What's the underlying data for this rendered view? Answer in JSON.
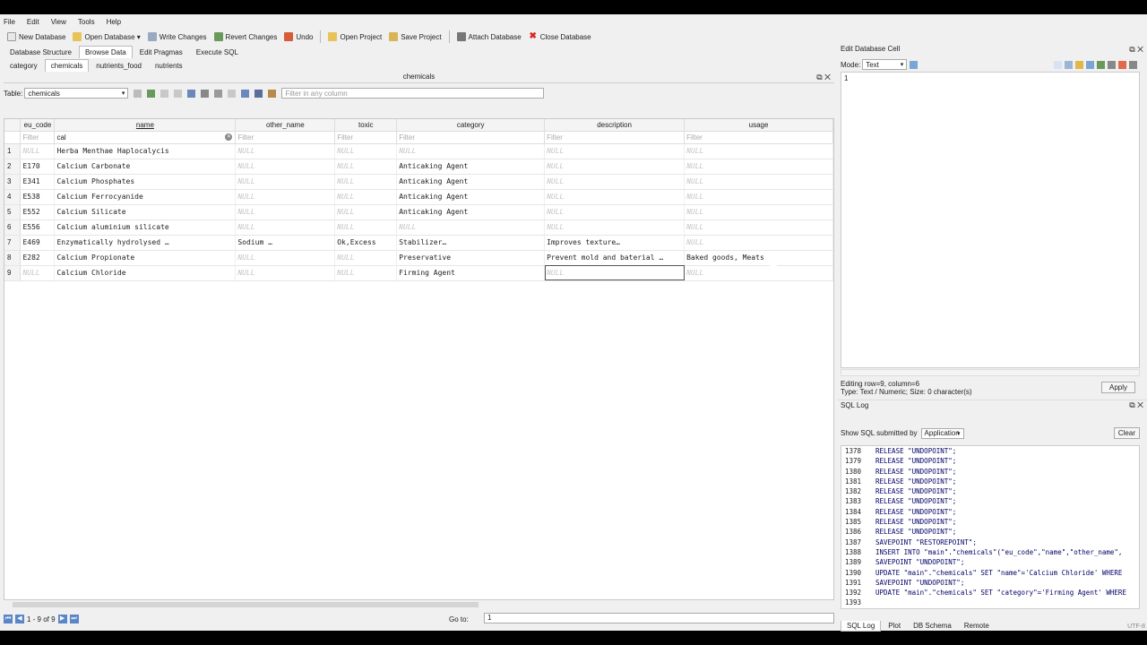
{
  "menu": [
    "File",
    "Edit",
    "View",
    "Tools",
    "Help"
  ],
  "toolbar": {
    "new_db": "New Database",
    "open_db": "Open Database",
    "write": "Write Changes",
    "revert": "Revert Changes",
    "undo": "Undo",
    "open_project": "Open Project",
    "save_project": "Save Project",
    "attach": "Attach Database",
    "close": "Close Database"
  },
  "main_tabs": [
    "Database Structure",
    "Browse Data",
    "Edit Pragmas",
    "Execute SQL"
  ],
  "sub_tabs": [
    "category",
    "chemicals",
    "nutrients_food",
    "nutrients"
  ],
  "panel_title": "chemicals",
  "table_label": "Table:",
  "table_value": "chemicals",
  "filter_all_placeholder": "Filter in any column",
  "columns": [
    "eu_code",
    "name",
    "other_name",
    "toxic",
    "category",
    "description",
    "usage"
  ],
  "filters": [
    "Filter",
    "cal",
    "Filter",
    "Filter",
    "Filter",
    "Filter",
    "Filter"
  ],
  "rows": [
    [
      "1",
      "NULL",
      "Herba Menthae Haplocalycis",
      "NULL",
      "NULL",
      "NULL",
      "NULL",
      "NULL"
    ],
    [
      "2",
      "E170",
      "Calcium Carbonate",
      "NULL",
      "NULL",
      "Anticaking Agent",
      "NULL",
      "NULL"
    ],
    [
      "3",
      "E341",
      "Calcium Phosphates",
      "NULL",
      "NULL",
      "Anticaking Agent",
      "NULL",
      "NULL"
    ],
    [
      "4",
      "E538",
      "Calcium Ferrocyanide",
      "NULL",
      "NULL",
      "Anticaking Agent",
      "NULL",
      "NULL"
    ],
    [
      "5",
      "E552",
      "Calcium Silicate",
      "NULL",
      "NULL",
      "Anticaking Agent",
      "NULL",
      "NULL"
    ],
    [
      "6",
      "E556",
      "Calcium aluminium silicate",
      "NULL",
      "NULL",
      "NULL",
      "NULL",
      "NULL"
    ],
    [
      "7",
      "E469",
      "Enzymatically hydrolysed …",
      "Sodium …",
      "Ok,Excess",
      "Stabilizer…",
      "Improves texture…",
      "NULL"
    ],
    [
      "8",
      "E282",
      "Calcium Propionate",
      "NULL",
      "NULL",
      "Preservative",
      "Prevent mold and baterial …",
      "Baked goods, Meats"
    ],
    [
      "9",
      "NULL",
      "Calcium Chloride",
      "NULL",
      "NULL",
      "Firming Agent",
      "NULL",
      "NULL"
    ]
  ],
  "nav": {
    "range": "1 - 9 of 9",
    "goto_label": "Go to:",
    "goto_value": "1"
  },
  "edit_cell": {
    "title": "Edit Database Cell",
    "mode_label": "Mode:",
    "mode_value": "Text",
    "content": "1",
    "status1": "Editing row=9, column=6",
    "status2": "Type: Text / Numeric; Size: 0 character(s)",
    "apply": "Apply"
  },
  "sql_log": {
    "title": "SQL Log",
    "show_label": "Show SQL submitted by",
    "show_value": "Application",
    "clear": "Clear",
    "lines": [
      {
        "n": "1378",
        "t": "RELEASE \"UNDOPOINT\";"
      },
      {
        "n": "1379",
        "t": "RELEASE \"UNDOPOINT\";"
      },
      {
        "n": "1380",
        "t": "RELEASE \"UNDOPOINT\";"
      },
      {
        "n": "1381",
        "t": "RELEASE \"UNDOPOINT\";"
      },
      {
        "n": "1382",
        "t": "RELEASE \"UNDOPOINT\";"
      },
      {
        "n": "1383",
        "t": "RELEASE \"UNDOPOINT\";"
      },
      {
        "n": "1384",
        "t": "RELEASE \"UNDOPOINT\";"
      },
      {
        "n": "1385",
        "t": "RELEASE \"UNDOPOINT\";"
      },
      {
        "n": "1386",
        "t": "RELEASE \"UNDOPOINT\";"
      },
      {
        "n": "1387",
        "t": "SAVEPOINT \"RESTOREPOINT\";"
      },
      {
        "n": "1388",
        "t": "INSERT INTO \"main\".\"chemicals\"(\"eu_code\",\"name\",\"other_name\","
      },
      {
        "n": "1389",
        "t": "SAVEPOINT \"UNDOPOINT\";"
      },
      {
        "n": "1390",
        "t": "UPDATE \"main\".\"chemicals\" SET \"name\"='Calcium Chloride' WHERE"
      },
      {
        "n": "1391",
        "t": "SAVEPOINT \"UNDOPOINT\";"
      },
      {
        "n": "1392",
        "t": "UPDATE \"main\".\"chemicals\" SET \"category\"='Firming Agent' WHERE"
      },
      {
        "n": "1393",
        "t": ""
      }
    ]
  },
  "bottom_tabs": [
    "SQL Log",
    "Plot",
    "DB Schema",
    "Remote"
  ],
  "encoding": "UTF-8"
}
